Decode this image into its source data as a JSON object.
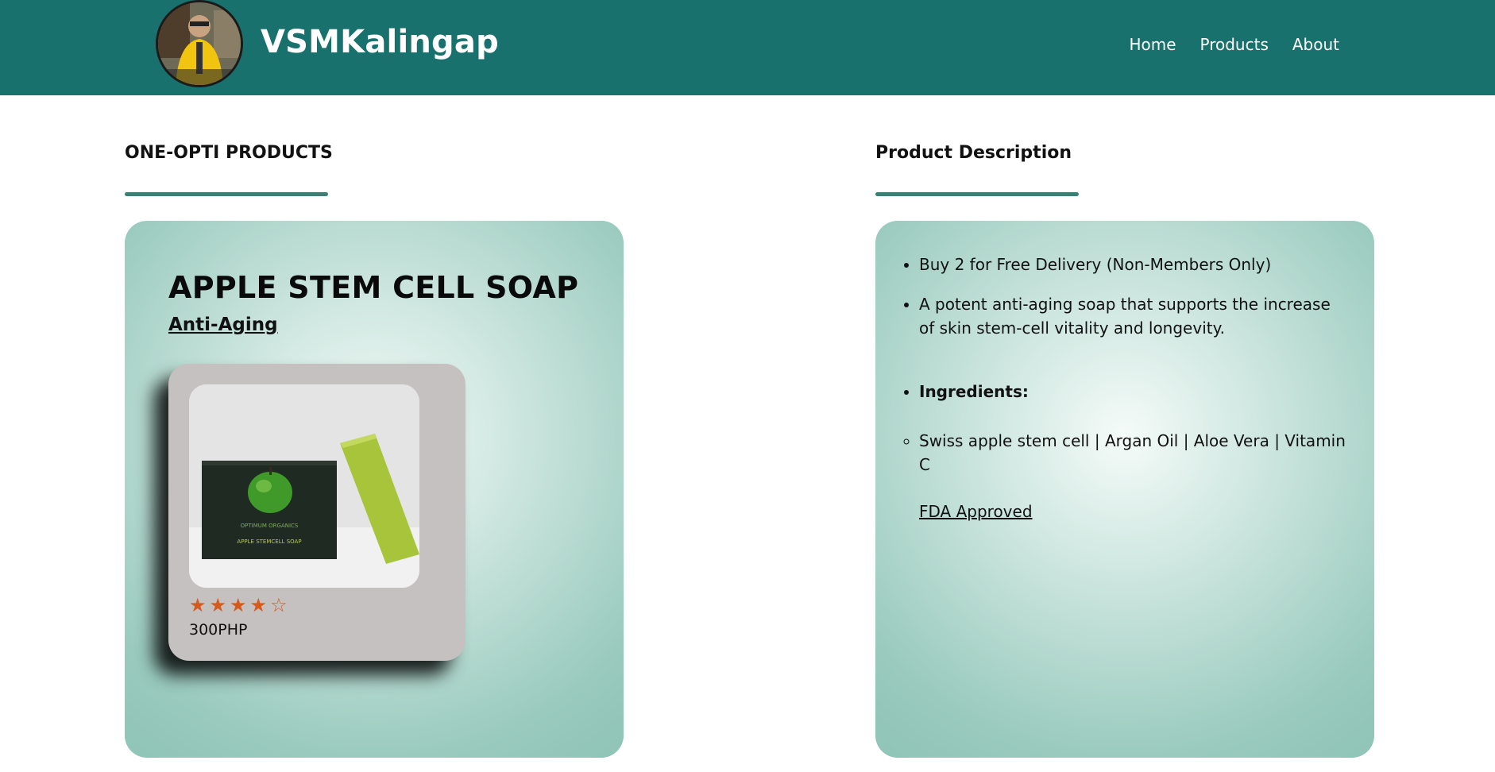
{
  "header": {
    "brand": "VSMKalingap",
    "nav": [
      "Home",
      "Products",
      "About"
    ]
  },
  "left_section": {
    "title": "ONE-OPTI PRODUCTS",
    "product": {
      "name": "APPLE STEM CELL SOAP",
      "category": "Anti-Aging",
      "rating": 4,
      "rating_max": 5,
      "price": "300PHP",
      "package_brand": "OPTIMUM ORGANICS",
      "package_label": "APPLE STEMCELL SOAP"
    }
  },
  "right_section": {
    "title": "Product Description",
    "bullets": [
      "Buy 2 for Free Delivery (Non-Members Only)",
      "A potent anti-aging soap that supports the increase of skin stem-cell vitality and longevity."
    ],
    "ingredients_label": "Ingredients:",
    "ingredients": "Swiss apple stem cell | Argan Oil | Aloe Vera | Vitamin C",
    "fda": "FDA Approved"
  },
  "colors": {
    "header_bg": "#18716d",
    "accent_rule": "#3e7e73",
    "star": "#d55a1e",
    "panel_edge": "#8fc4b6"
  }
}
